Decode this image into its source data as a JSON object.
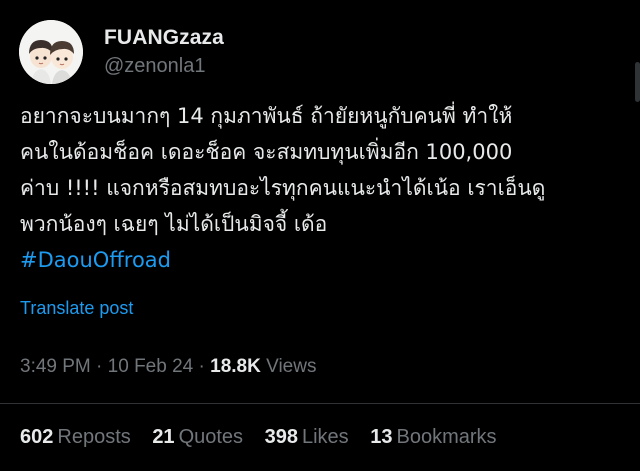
{
  "user": {
    "display_name": "FUANGzaza",
    "handle": "@zenonla1"
  },
  "tweet": {
    "lines": [
      "อยากจะบนมากๆ 14 กุมภาพันธ์ ถ้ายัยหนูกับคนพี่ ทำให้",
      "คนในด้อมช็อค เดอะช็อค จะสมทบทุนเพิ่มอีก 100,000",
      "ค่าบ !!!! แจกหรือสมทบอะไรทุกคนแนะนำได้เน้อ เราเอ็นดู",
      "พวกน้องๆ เฉยๆ ไม่ได้เป็นมิจจี้ เด้อ"
    ],
    "hashtag": "#DaouOffroad"
  },
  "translate_label": "Translate post",
  "meta": {
    "time": "3:49 PM",
    "separator": " · ",
    "date": "10 Feb 24",
    "views_count": "18.8K",
    "views_label": "Views"
  },
  "stats": [
    {
      "count": "602",
      "label": "Reposts"
    },
    {
      "count": "21",
      "label": "Quotes"
    },
    {
      "count": "398",
      "label": "Likes"
    },
    {
      "count": "13",
      "label": "Bookmarks"
    }
  ],
  "colors": {
    "background": "#000000",
    "text": "#e7e9ea",
    "secondary": "#71767b",
    "link": "#1d9bf0",
    "divider": "#2f3336"
  }
}
